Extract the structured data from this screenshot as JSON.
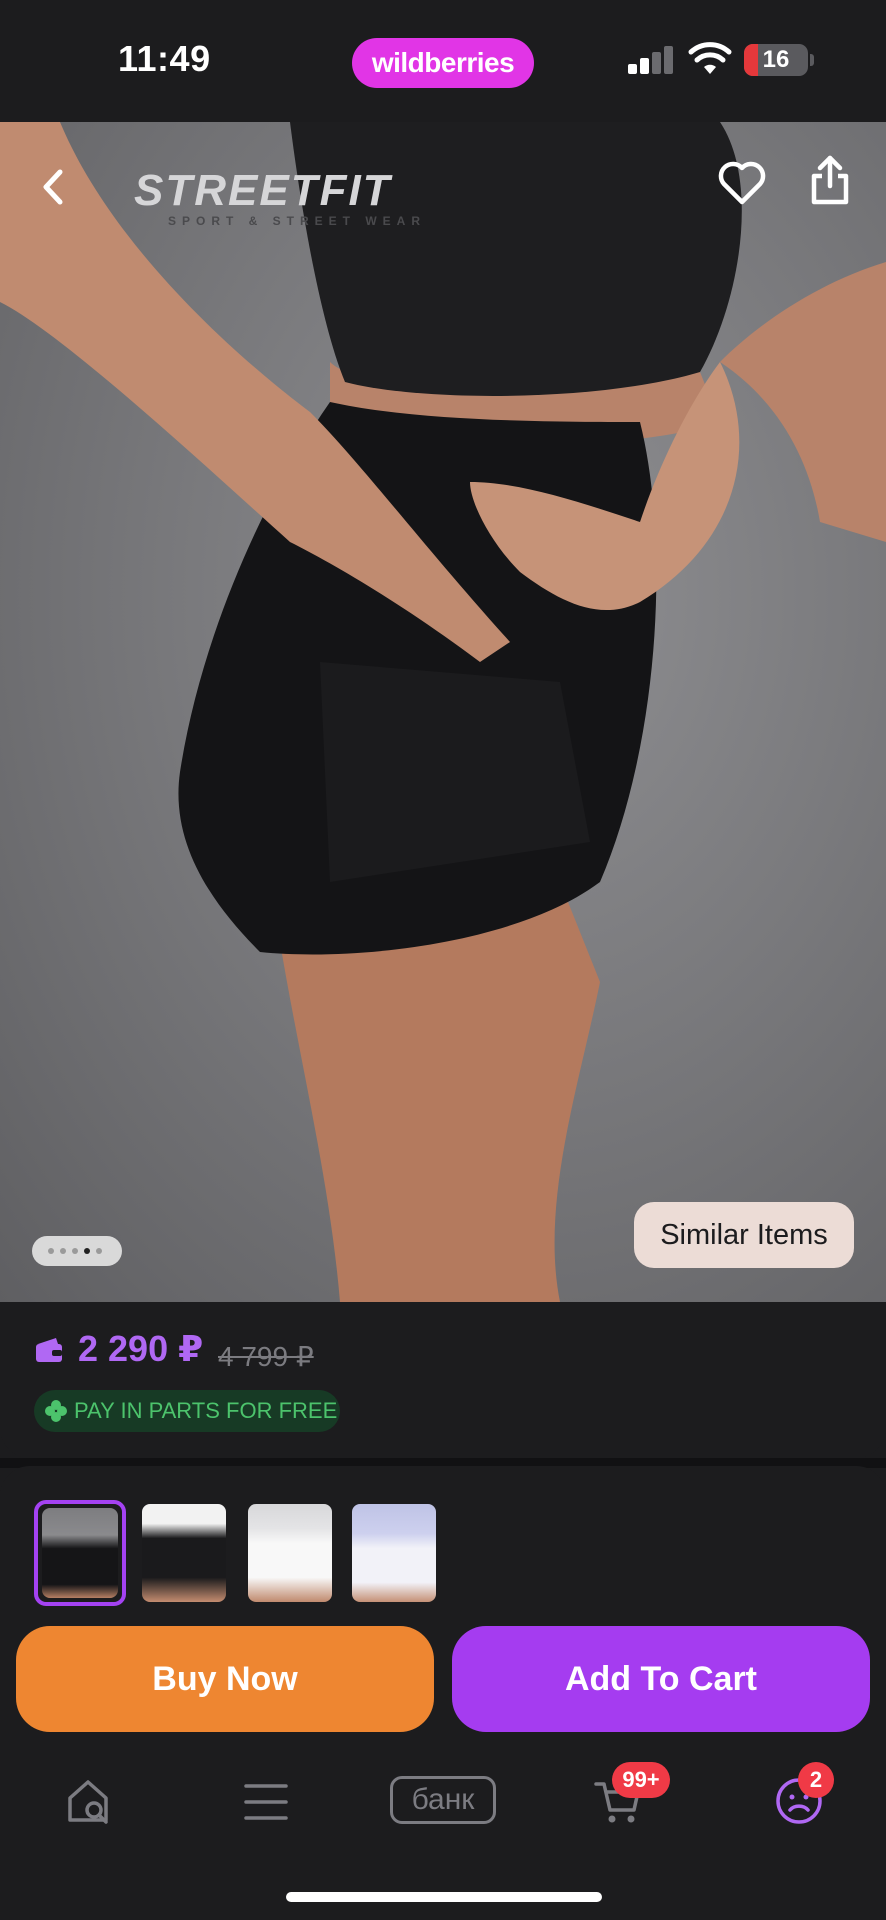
{
  "status_bar": {
    "time": "11:49",
    "app_pill": "wildberries",
    "battery": "16"
  },
  "product": {
    "brand_logo": "STREETFIT",
    "brand_tagline": "SPORT & STREET WEAR",
    "image_count": 5,
    "active_image_index": 3,
    "similar_label": "Similar Items"
  },
  "price": {
    "current": "2 290 ₽",
    "old": "4 799 ₽",
    "installments": "PAY IN PARTS FOR FREE"
  },
  "variants": [
    {
      "name": "black-skirt-shorts",
      "selected": true
    },
    {
      "name": "black-skirt-shorts-alt",
      "selected": false
    },
    {
      "name": "white-skirt-shorts",
      "selected": false
    },
    {
      "name": "white-skirt-shorts-alt",
      "selected": false
    }
  ],
  "actions": {
    "buy_now": "Buy Now",
    "add_to_cart": "Add To Cart"
  },
  "tabbar": {
    "home_icon": "home-search-icon",
    "catalog_icon": "menu-icon",
    "bank_label": "банк",
    "cart_badge": "99+",
    "profile_badge": "2"
  },
  "colors": {
    "brand_pink": "#e135e6",
    "price_purple": "#b068f3",
    "buy_orange": "#ee8631",
    "cart_purple": "#a53cf0",
    "badge_red": "#f03a46",
    "installment_green": "#4cc36c"
  }
}
